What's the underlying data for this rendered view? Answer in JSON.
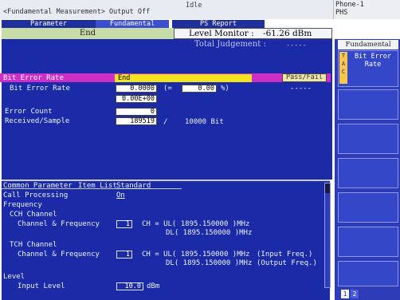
{
  "header": {
    "screen_title": "<Fundamental Measurement> Output Off",
    "status": "Idle",
    "phone_name": "Phone-1",
    "phone_system": "PHS"
  },
  "tabs": [
    {
      "label": "Parameter"
    },
    {
      "label": "Fundamental"
    },
    {
      "label": "PS Report"
    }
  ],
  "measure_status": "End",
  "level_monitor": {
    "label": "Level Monitor :",
    "value": "-61.26 dBm"
  },
  "judgement": {
    "label": "Total Judgement :",
    "value": "-----"
  },
  "bit_error": {
    "header_label": "Bit Error Rate",
    "header_value": "End",
    "pass_fail_label": "Pass/Fail",
    "rate_label": "Bit Error Rate",
    "rate_value": "0.0000",
    "paren_open": "(=",
    "percent_value": "0.00",
    "percent_unit": "%)",
    "percent_judge": "-----",
    "rate_exp": "0.00E+00",
    "error_count_label": "Error Count",
    "error_count": "0",
    "received_label": "Received/Sample",
    "received": "189519",
    "sample_sep": "/",
    "sample": "10000 Bit"
  },
  "softkeys": {
    "header": "Fundamental",
    "key1_label": "Bit Error Rate",
    "key1_side": "T\nA\nC"
  },
  "pages": [
    "1",
    "2"
  ],
  "common": {
    "title": "Common Parameter",
    "item_list_label": "Item List",
    "item_list_value": "Standard",
    "call_processing_label": "Call Processing",
    "call_processing_value": "On",
    "frequency_label": "Frequency",
    "cch_label": "CCH Channel",
    "cch_channel_label": "Channel & Frequency",
    "cch_channel_value": "1",
    "cch_ul": "CH = UL( 1895.150000 )MHz",
    "cch_dl": "DL( 1895.150000 )MHz",
    "tch_label": "TCH Channel",
    "tch_channel_label": "Channel & Frequency",
    "tch_channel_value": "1",
    "tch_ul": "CH = UL( 1895.150000 )MHz",
    "tch_ul_note": "(Input Freq.)",
    "tch_dl": "DL( 1895.150000 )MHz",
    "tch_dl_note": "(Output Freq.)",
    "level_label": "Level",
    "input_level_label": "Input Level",
    "input_level_value": "10.0",
    "input_level_unit": "dBm"
  }
}
